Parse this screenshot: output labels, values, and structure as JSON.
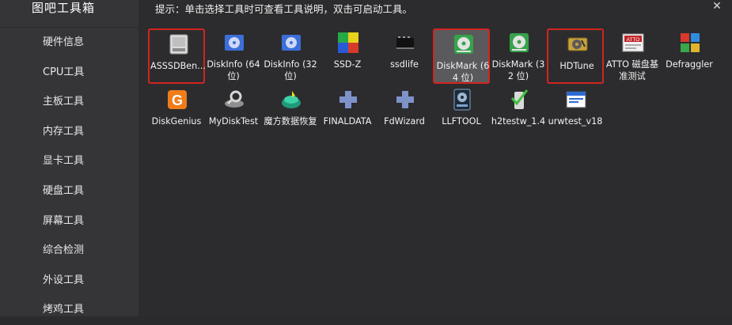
{
  "app": {
    "title": "图吧工具箱"
  },
  "sidebar": {
    "items": [
      {
        "label": "硬件信息"
      },
      {
        "label": "CPU工具"
      },
      {
        "label": "主板工具"
      },
      {
        "label": "内存工具"
      },
      {
        "label": "显卡工具"
      },
      {
        "label": "硬盘工具"
      },
      {
        "label": "屏幕工具"
      },
      {
        "label": "综合检测"
      },
      {
        "label": "外设工具"
      },
      {
        "label": "烤鸡工具"
      }
    ]
  },
  "header": {
    "hint": "提示：单击选择工具时可查看工具说明，双击可启动工具。",
    "close_icon": "close-icon"
  },
  "accent": {
    "highlight": "#d3241f",
    "selected": "#5a5a5c"
  },
  "tools": [
    {
      "label": "ASSSDBen...",
      "icon": "drive-icon"
    },
    {
      "label": "DiskInfo (64 位)",
      "icon": "diskinfo-icon"
    },
    {
      "label": "DiskInfo (32 位)",
      "icon": "diskinfo-icon"
    },
    {
      "label": "SSD-Z",
      "icon": "ssdz-icon"
    },
    {
      "label": "ssdlife",
      "icon": "chip-icon"
    },
    {
      "label": "DiskMark (64 位)",
      "icon": "diskmark-icon"
    },
    {
      "label": "DiskMark (32 位)",
      "icon": "diskmark-icon"
    },
    {
      "label": "HDTune",
      "icon": "hdd-icon"
    },
    {
      "label": "ATTO 磁盘基准测试",
      "icon": "atto-icon"
    },
    {
      "label": "Defraggler",
      "icon": "defrag-icon"
    },
    {
      "label": "DiskGenius",
      "icon": "diskgenius-icon"
    },
    {
      "label": "MyDiskTest",
      "icon": "magnifier-icon"
    },
    {
      "label": "魔方数据恢复",
      "icon": "recovery-icon"
    },
    {
      "label": "FINALDATA",
      "icon": "puzzle-icon"
    },
    {
      "label": "FdWizard",
      "icon": "puzzle-icon"
    },
    {
      "label": "LLFTOOL",
      "icon": "llf-icon"
    },
    {
      "label": "h2testw_1.4",
      "icon": "check-icon"
    },
    {
      "label": "urwtest_v18",
      "icon": "window-icon"
    }
  ]
}
